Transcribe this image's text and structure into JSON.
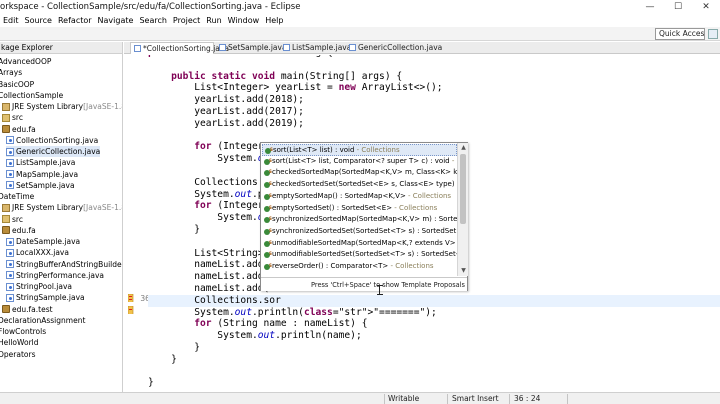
{
  "window": {
    "title": "orkspace - CollectionSample/src/edu/fa/CollectionSorting.java - Eclipse",
    "controls": [
      "—",
      "☐",
      "✕"
    ]
  },
  "menu": [
    "Edit",
    "Source",
    "Refactor",
    "Navigate",
    "Search",
    "Project",
    "Run",
    "Window",
    "Help"
  ],
  "toolbar": {
    "quick_access": "Quick Access"
  },
  "package_explorer": {
    "title": "kage Explorer",
    "items": [
      {
        "label": "AdvancedOOP",
        "suffix": "",
        "icon": "project-icon"
      },
      {
        "label": "Arrays",
        "suffix": "",
        "icon": "project-icon"
      },
      {
        "label": "BasicOOP",
        "suffix": "",
        "icon": "project-icon"
      },
      {
        "label": "CollectionSample",
        "suffix": "",
        "icon": "project-icon"
      },
      {
        "label": "JRE System Library",
        "suffix": " [JavaSE-1.8]",
        "icon": "library-icon"
      },
      {
        "label": "src",
        "suffix": "",
        "icon": "source-folder-icon"
      },
      {
        "label": "edu.fa",
        "suffix": "",
        "icon": "package-icon"
      },
      {
        "label": "CollectionSorting.java",
        "suffix": "",
        "icon": "java-file-icon"
      },
      {
        "label": "GenericCollection.java",
        "suffix": "",
        "icon": "java-file-icon"
      },
      {
        "label": "ListSample.java",
        "suffix": "",
        "icon": "java-file-icon"
      },
      {
        "label": "MapSample.java",
        "suffix": "",
        "icon": "java-file-icon"
      },
      {
        "label": "SetSample.java",
        "suffix": "",
        "icon": "java-file-icon"
      },
      {
        "label": "DateTime",
        "suffix": "",
        "icon": "project-icon"
      },
      {
        "label": "JRE System Library",
        "suffix": " [JavaSE-1.8]",
        "icon": "library-icon"
      },
      {
        "label": "src",
        "suffix": "",
        "icon": "source-folder-icon"
      },
      {
        "label": "edu.fa",
        "suffix": "",
        "icon": "package-icon"
      },
      {
        "label": "DateSample.java",
        "suffix": "",
        "icon": "java-file-icon"
      },
      {
        "label": "LocalXXX.java",
        "suffix": "",
        "icon": "java-file-icon"
      },
      {
        "label": "StringBufferAndStringBuilder.java",
        "suffix": "",
        "icon": "java-file-icon"
      },
      {
        "label": "StringPerformance.java",
        "suffix": "",
        "icon": "java-file-icon"
      },
      {
        "label": "StringPool.java",
        "suffix": "",
        "icon": "java-file-icon"
      },
      {
        "label": "StringSample.java",
        "suffix": "",
        "icon": "java-file-icon"
      },
      {
        "label": "edu.fa.test",
        "suffix": "",
        "icon": "package-icon"
      },
      {
        "label": "DeclarationAssignment",
        "suffix": "",
        "icon": "project-icon"
      },
      {
        "label": "FlowControls",
        "suffix": "",
        "icon": "project-icon"
      },
      {
        "label": "HelloWorld",
        "suffix": "",
        "icon": "project-icon"
      },
      {
        "label": "Operators",
        "suffix": "",
        "icon": "project-icon"
      }
    ]
  },
  "editor_tabs": [
    {
      "label": "*CollectionSorting.java",
      "active": true
    },
    {
      "label": "SetSample.java",
      "active": false
    },
    {
      "label": "ListSample.java",
      "active": false
    },
    {
      "label": "GenericCollection.java",
      "active": false
    }
  ],
  "editor": {
    "line_numbers": {
      "n36": "36"
    },
    "lines": [
      "public class CollectionSorting {",
      "",
      "    public static void main(String[] args) {",
      "        List<Integer> yearList = new ArrayList<>();",
      "        yearList.add(2018);",
      "        yearList.add(2017);",
      "        yearList.add(2019);",
      "",
      "        for (Integer",
      "            System.out",
      "",
      "        Collections.s",
      "        System.out.pr",
      "        for (Integer",
      "            System.out",
      "        }",
      "",
      "        List<String> ",
      "        nameList.add(",
      "        nameList.add(",
      "        nameList.add(",
      "        Collections.sor",
      "        System.out.println(\"=======\");",
      "        for (String name : nameList) {",
      "            System.out.println(name);",
      "        }",
      "    }",
      "",
      "}"
    ]
  },
  "content_assist": {
    "proposals": [
      {
        "name": "sort(List<T> list) : void",
        "owner": " - Collections"
      },
      {
        "name": "sort(List<T> list, Comparator<? super T> c) : void",
        "owner": " - Collecti"
      },
      {
        "name": "checkedSortedMap(SortedMap<K,V> m, Class<K> keyType,",
        "owner": ""
      },
      {
        "name": "checkedSortedSet(SortedSet<E> s, Class<E> type) : SortedS",
        "owner": ""
      },
      {
        "name": "emptySortedMap() : SortedMap<K,V>",
        "owner": " - Collections"
      },
      {
        "name": "emptySortedSet() : SortedSet<E>",
        "owner": " - Collections"
      },
      {
        "name": "synchronizedSortedMap(SortedMap<K,V> m) : SortedMap<",
        "owner": ""
      },
      {
        "name": "synchronizedSortedSet(SortedSet<T> s) : SortedSet<T> - C",
        "owner": ""
      },
      {
        "name": "unmodifiableSortedMap(SortedMap<K,? extends V> m) : S",
        "owner": ""
      },
      {
        "name": "unmodifiableSortedSet(SortedSet<T> s) : SortedSet<T> - C",
        "owner": ""
      },
      {
        "name": "reverseOrder() : Comparator<T>",
        "owner": " - Collections"
      }
    ],
    "status": "Press 'Ctrl+Space' to show Template Proposals"
  },
  "statusbar": {
    "writable": "Writable",
    "insert_mode": "Smart Insert",
    "position": "36 : 24"
  },
  "colors": {
    "keyword": "#7f0055",
    "field": "#0000c0",
    "string": "#2a00ff",
    "current_line": "#e8f2fe",
    "selection": "#dfe9f6"
  }
}
